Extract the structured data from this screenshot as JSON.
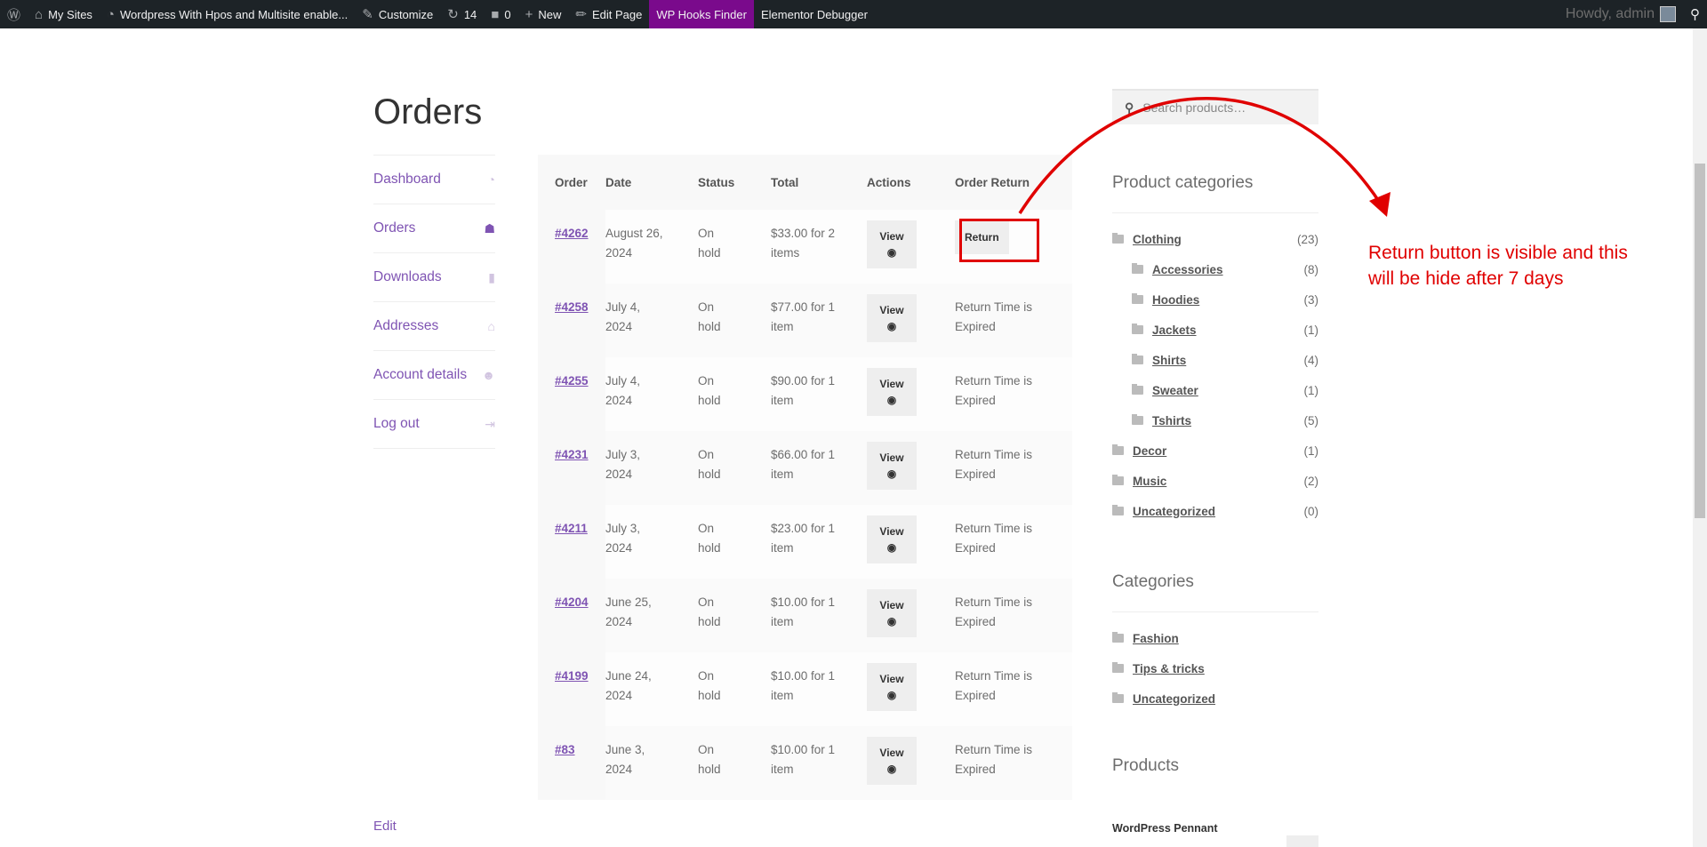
{
  "adminbar": {
    "items": [
      {
        "icon": "wordpress-icon",
        "label": ""
      },
      {
        "icon": "my-sites-icon",
        "label": "My Sites"
      },
      {
        "icon": "dashboard-icon",
        "label": "Wordpress With Hpos and Multisite enable..."
      },
      {
        "icon": "customize-icon",
        "label": "Customize"
      },
      {
        "icon": "updates-icon",
        "label": "14"
      },
      {
        "icon": "comments-icon",
        "label": "0"
      },
      {
        "icon": "plus-icon",
        "label": "New"
      },
      {
        "icon": "pencil-icon",
        "label": "Edit Page"
      },
      {
        "icon": "",
        "label": "WP Hooks Finder"
      },
      {
        "icon": "",
        "label": "Elementor Debugger"
      }
    ],
    "howdy": "Howdy, admin"
  },
  "page": {
    "title": "Orders",
    "edit": "Edit"
  },
  "nav": [
    {
      "label": "Dashboard",
      "icon": "dashboard-icon"
    },
    {
      "label": "Orders",
      "icon": "basket-icon"
    },
    {
      "label": "Downloads",
      "icon": "file-icon"
    },
    {
      "label": "Addresses",
      "icon": "home-icon"
    },
    {
      "label": "Account details",
      "icon": "user-icon"
    },
    {
      "label": "Log out",
      "icon": "logout-icon"
    }
  ],
  "table": {
    "headers": [
      "Order",
      "Date",
      "Status",
      "Total",
      "Actions",
      "Order Return"
    ],
    "view_label": "View",
    "return_label": "Return",
    "expired_1": "Return Time is",
    "expired_2": "Expired",
    "rows": [
      {
        "order": "#4262",
        "date1": "August 26,",
        "date2": "2024",
        "s1": "On",
        "s2": "hold",
        "t1": "$33.00 for 2",
        "t2": "items",
        "returnable": true
      },
      {
        "order": "#4258",
        "date1": "July 4,",
        "date2": "2024",
        "s1": "On",
        "s2": "hold",
        "t1": "$77.00 for 1",
        "t2": "item",
        "returnable": false
      },
      {
        "order": "#4255",
        "date1": "July 4,",
        "date2": "2024",
        "s1": "On",
        "s2": "hold",
        "t1": "$90.00 for 1",
        "t2": "item",
        "returnable": false
      },
      {
        "order": "#4231",
        "date1": "July 3,",
        "date2": "2024",
        "s1": "On",
        "s2": "hold",
        "t1": "$66.00 for 1",
        "t2": "item",
        "returnable": false
      },
      {
        "order": "#4211",
        "date1": "July 3,",
        "date2": "2024",
        "s1": "On",
        "s2": "hold",
        "t1": "$23.00 for 1",
        "t2": "item",
        "returnable": false
      },
      {
        "order": "#4204",
        "date1": "June 25,",
        "date2": "2024",
        "s1": "On",
        "s2": "hold",
        "t1": "$10.00 for 1",
        "t2": "item",
        "returnable": false
      },
      {
        "order": "#4199",
        "date1": "June 24,",
        "date2": "2024",
        "s1": "On",
        "s2": "hold",
        "t1": "$10.00 for 1",
        "t2": "item",
        "returnable": false
      },
      {
        "order": "#83",
        "date1": "June 3,",
        "date2": "2024",
        "s1": "On",
        "s2": "hold",
        "t1": "$10.00 for 1",
        "t2": "item",
        "returnable": false
      }
    ]
  },
  "sidebar": {
    "search_placeholder": "Search products…",
    "product_categories_title": "Product categories",
    "product_categories": [
      {
        "name": "Clothing",
        "count": "(23)",
        "sub": false
      },
      {
        "name": "Accessories",
        "count": "(8)",
        "sub": true
      },
      {
        "name": "Hoodies",
        "count": "(3)",
        "sub": true
      },
      {
        "name": "Jackets",
        "count": "(1)",
        "sub": true
      },
      {
        "name": "Shirts",
        "count": "(4)",
        "sub": true
      },
      {
        "name": "Sweater",
        "count": "(1)",
        "sub": true
      },
      {
        "name": "Tshirts",
        "count": "(5)",
        "sub": true
      },
      {
        "name": "Decor",
        "count": "(1)",
        "sub": false
      },
      {
        "name": "Music",
        "count": "(2)",
        "sub": false
      },
      {
        "name": "Uncategorized",
        "count": "(0)",
        "sub": false
      }
    ],
    "categories_title": "Categories",
    "categories": [
      "Fashion",
      "Tips & tricks",
      "Uncategorized"
    ],
    "products_title": "Products",
    "products": [
      "WordPress Pennant"
    ]
  },
  "annotation": {
    "text": "Return button is visible and this will be hide after 7 days",
    "color": "#e00000"
  }
}
